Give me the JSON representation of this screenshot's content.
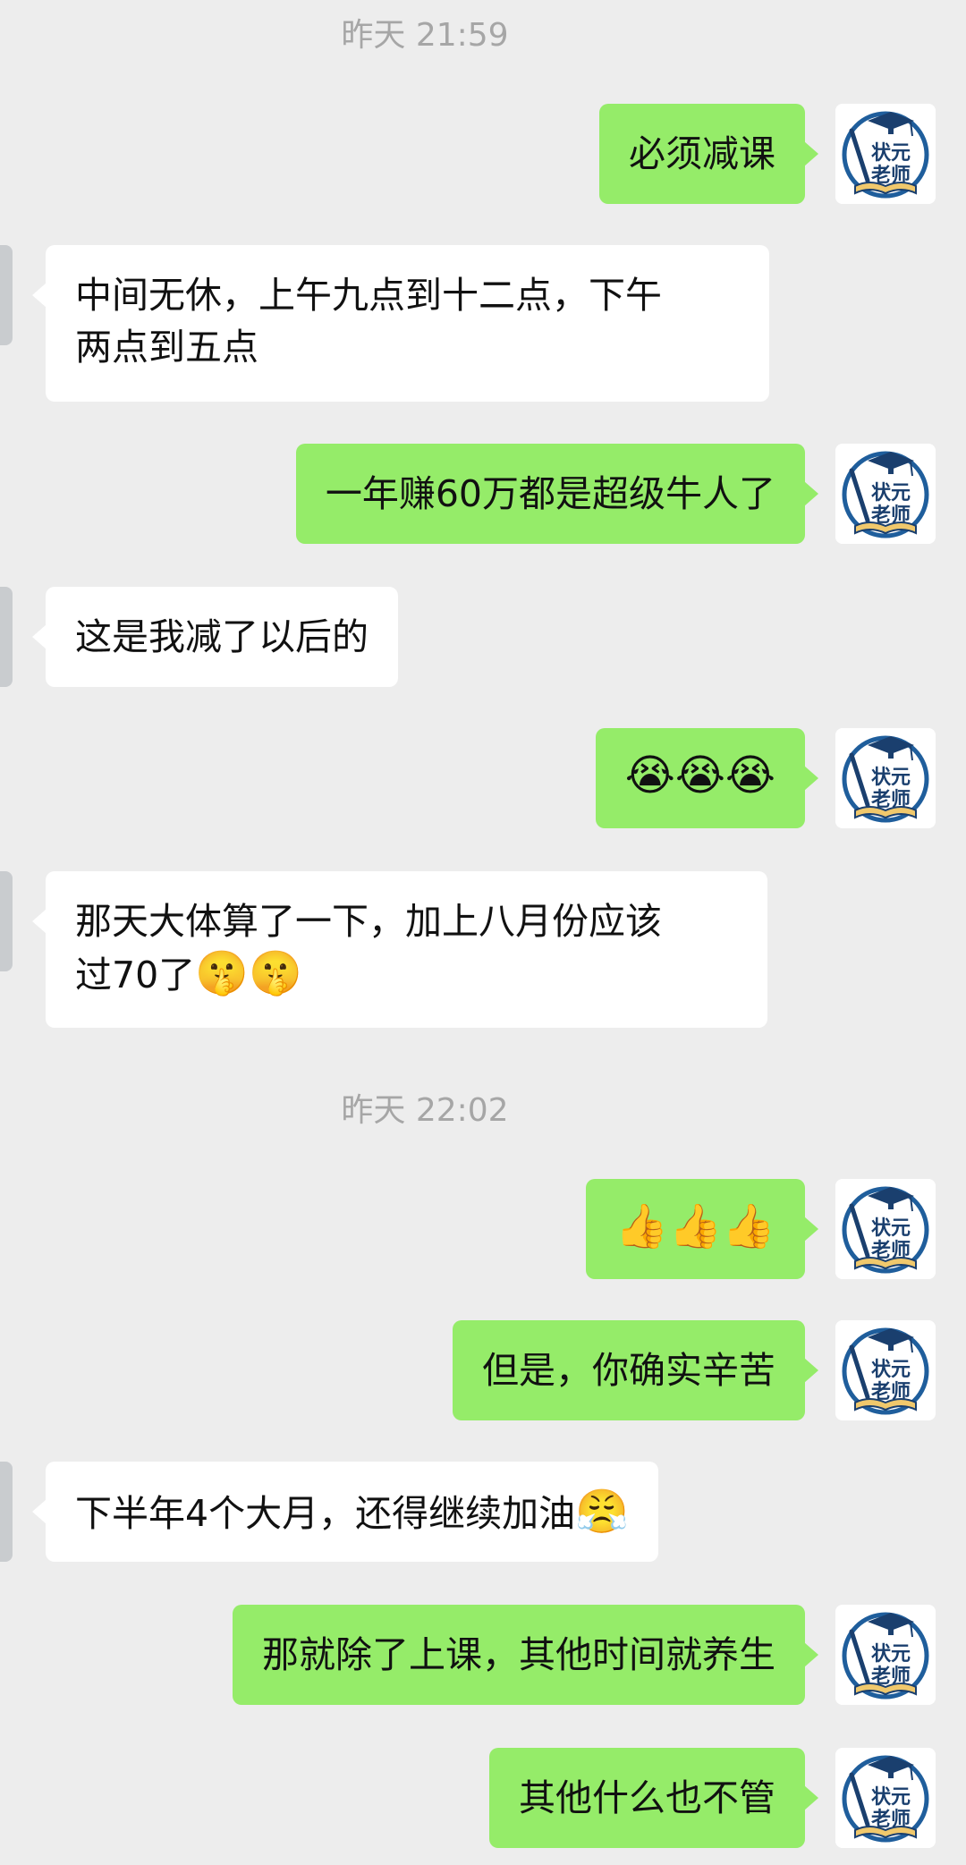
{
  "timestamps": [
    "昨天 21:59",
    "昨天 22:02"
  ],
  "avatar_label": "状元老师",
  "messages": [
    {
      "text": "必须减课"
    },
    {
      "text": "中间无休，上午九点到十二点，下午",
      "text2": "两点到五点"
    },
    {
      "text": "一年赚60万都是超级牛人了"
    },
    {
      "text": "这是我减了以后的"
    },
    {
      "emoji": "😭😭😭"
    },
    {
      "text": "那天大体算了一下，加上八月份应该",
      "text2": "过70了",
      "emoji": "🤫🤫"
    },
    {
      "emoji": "👍👍👍"
    },
    {
      "text": "但是，你确实辛苦"
    },
    {
      "text": "下半年4个大月，还得继续加油",
      "emoji": "😤"
    },
    {
      "text": "那就除了上课，其他时间就养生"
    },
    {
      "text": "其他什么也不管"
    }
  ]
}
